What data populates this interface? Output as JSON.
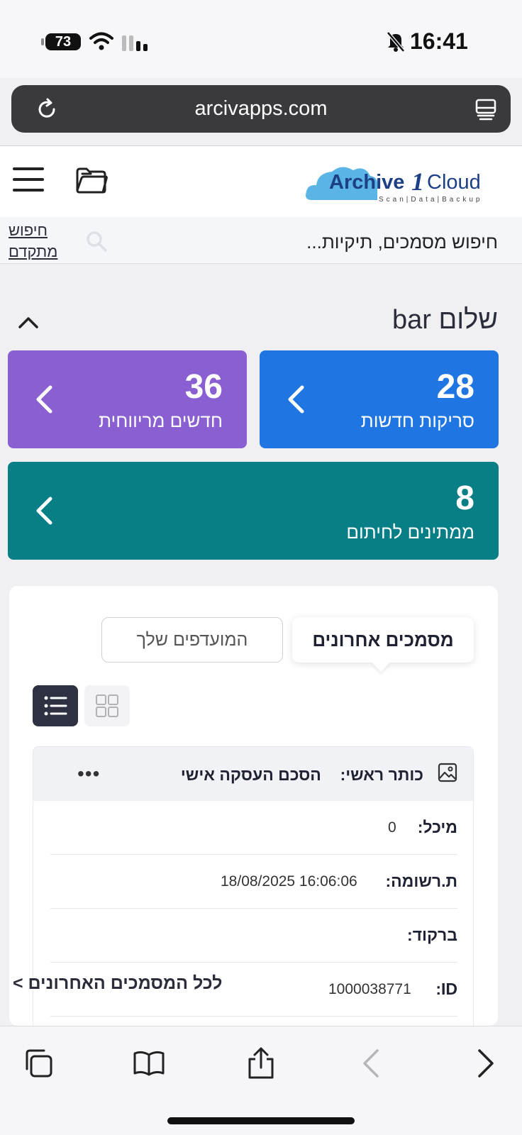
{
  "status_bar": {
    "battery": "73",
    "time": "16:41"
  },
  "browser": {
    "url": "arcivapps.com"
  },
  "header": {
    "logo_text_main": "Archive",
    "logo_text_num": "1",
    "logo_text_end": "Cloud",
    "logo_tagline": "Scan|Data|Backup"
  },
  "search": {
    "placeholder": "חיפוש מסמכים, תיקיות...",
    "advanced_line1": "חיפוש",
    "advanced_line2": "מתקדם"
  },
  "greeting": "שלום bar",
  "stats": [
    {
      "value": "28",
      "label": "סריקות חדשות",
      "color": "#1f75e2"
    },
    {
      "value": "36",
      "label": "חדשים מריווחית",
      "color": "#8a5fd1"
    },
    {
      "value": "8",
      "label": "ממתינים לחיתום",
      "color": "#087e86"
    }
  ],
  "tabs": {
    "active": "מסמכים אחרונים",
    "inactive": "המועדפים שלך"
  },
  "document": {
    "title_label": "כותר ראשי:",
    "title_value": "הסכם העסקה אישי",
    "fields": [
      {
        "label": "מיכל:",
        "value": "0"
      },
      {
        "label": "ת.רשומה:",
        "value": "18/08/2025 16:06:06"
      },
      {
        "label": "ברקוד:",
        "value": ""
      },
      {
        "label": "ID:",
        "value": "1000038771"
      }
    ]
  },
  "all_documents_link": "לכל המסמכים האחרונים >"
}
